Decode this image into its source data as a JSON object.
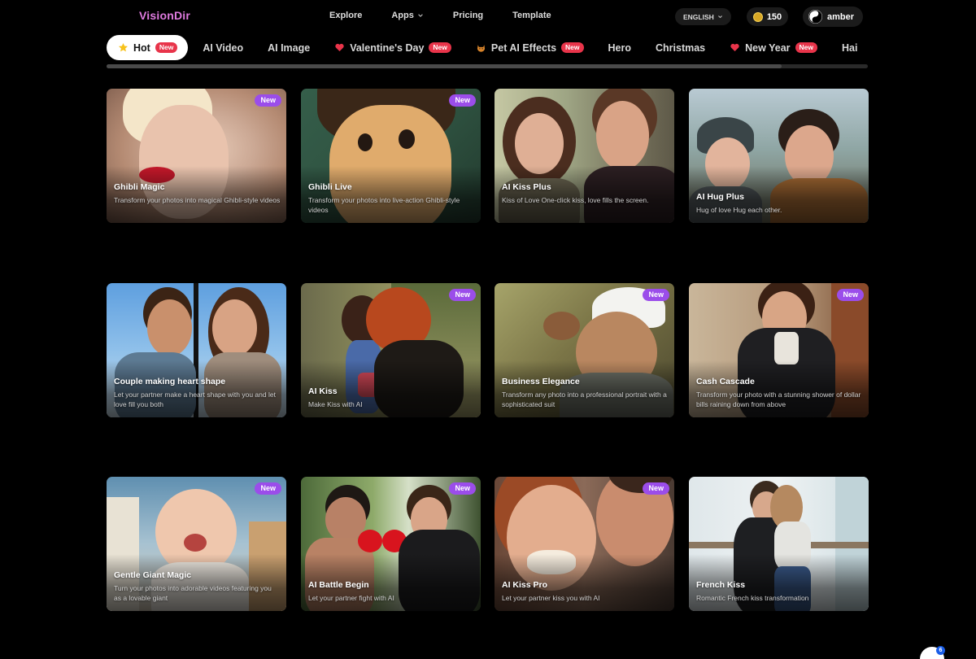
{
  "header": {
    "logo": "VisionDir",
    "nav": [
      {
        "label": "Explore"
      },
      {
        "label": "Apps"
      },
      {
        "label": "Pricing"
      },
      {
        "label": "Template"
      }
    ],
    "language": "ENGLISH",
    "credits": "150",
    "username": "amber"
  },
  "tabs": [
    {
      "label": "Hot",
      "badge": "New",
      "icon": "star-icon",
      "active": true
    },
    {
      "label": "AI Video"
    },
    {
      "label": "AI Image"
    },
    {
      "label": "Valentine's Day",
      "badge": "New",
      "icon": "heart-icon"
    },
    {
      "label": "Pet AI Effects",
      "badge": "New",
      "icon": "cat-icon"
    },
    {
      "label": "Hero"
    },
    {
      "label": "Christmas"
    },
    {
      "label": "New Year",
      "badge": "New",
      "icon": "heart-icon"
    },
    {
      "label": "Hai"
    }
  ],
  "cards": [
    {
      "title": "Ghibli Magic",
      "desc": "Transform your photos into magical Ghibli-style videos",
      "badge": "New"
    },
    {
      "title": "Ghibli Live",
      "desc": "Transform your photos into live-action Ghibli-style videos",
      "badge": "New"
    },
    {
      "title": "AI Kiss Plus",
      "desc": "Kiss of Love One-click kiss, love fills the screen.",
      "badge": ""
    },
    {
      "title": "AI Hug Plus",
      "desc": "Hug of love Hug each other.",
      "badge": ""
    },
    {
      "title": "Couple making heart shape",
      "desc": "Let your partner make a heart shape with you and let love fill you both",
      "badge": ""
    },
    {
      "title": "AI Kiss",
      "desc": "Make Kiss with AI",
      "badge": "New"
    },
    {
      "title": "Business Elegance",
      "desc": "Transform any photo into a professional portrait with a sophisticated suit",
      "badge": "New"
    },
    {
      "title": "Cash Cascade",
      "desc": "Transform your photo with a stunning shower of dollar bills raining down from above",
      "badge": "New"
    },
    {
      "title": "Gentle Giant Magic",
      "desc": "Turn your photos into adorable videos featuring you as a lovable giant",
      "badge": "New"
    },
    {
      "title": "AI Battle Begin",
      "desc": "Let your partner fight with AI",
      "badge": "New"
    },
    {
      "title": "AI Kiss Pro",
      "desc": "Let your partner kiss you with AI",
      "badge": "New"
    },
    {
      "title": "French Kiss",
      "desc": "Romantic French kiss transformation",
      "badge": ""
    }
  ],
  "help": {
    "count": "6"
  }
}
